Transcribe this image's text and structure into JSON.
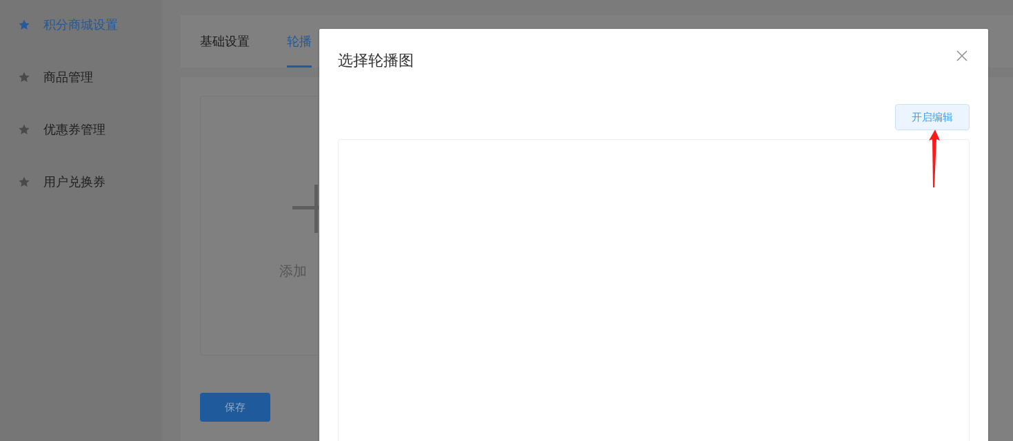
{
  "sidebar": {
    "items": [
      {
        "label": "积分商城设置",
        "selected": true
      },
      {
        "label": "商品管理",
        "selected": false
      },
      {
        "label": "优惠券管理",
        "selected": false
      },
      {
        "label": "用户兑换券",
        "selected": false
      }
    ]
  },
  "tabs": [
    {
      "label": "基础设置",
      "selected": false
    },
    {
      "label": "轮播",
      "selected": true
    }
  ],
  "upload": {
    "label": "添加"
  },
  "save_button": "保存",
  "modal": {
    "title": "选择轮播图",
    "edit_button": "开启编辑"
  }
}
